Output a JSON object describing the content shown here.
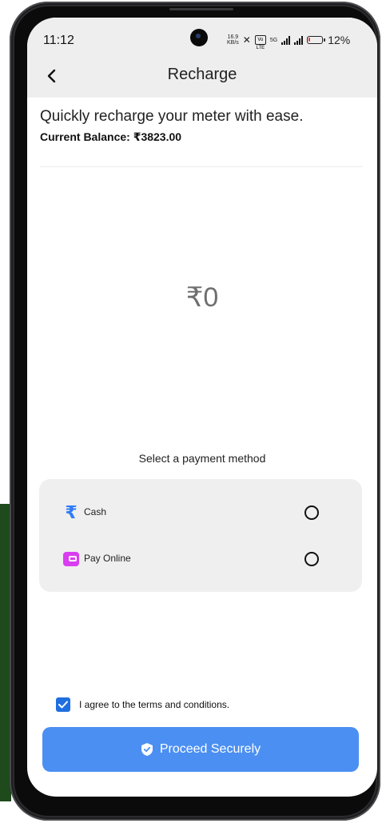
{
  "status_bar": {
    "time": "11:12",
    "net_speed_value": "16.9",
    "net_speed_unit": "KB/s",
    "lte_badge": "Vo LTE",
    "network_5g": "5G",
    "battery_percent": "12%",
    "battery_level": 0.12,
    "battery_color": "#e53935"
  },
  "header": {
    "title": "Recharge",
    "back_icon": "chevron-left-icon"
  },
  "intro": {
    "subtitle": "Quickly recharge your meter with ease.",
    "balance": "Current Balance: ₹3823.00"
  },
  "amount": {
    "display": "₹0"
  },
  "payment": {
    "heading": "Select a payment method",
    "options": [
      {
        "label": "Cash",
        "icon": "rupee-icon",
        "icon_color": "#2f7cf6",
        "selected": false
      },
      {
        "label": "Pay Online",
        "icon": "wallet-icon",
        "icon_color": "#d93df0",
        "selected": false
      }
    ]
  },
  "terms": {
    "label": "I agree to the terms and conditions.",
    "checked": true
  },
  "proceed": {
    "label": "Proceed Securely",
    "icon": "shield-check-icon",
    "color": "#4b8ff2"
  }
}
